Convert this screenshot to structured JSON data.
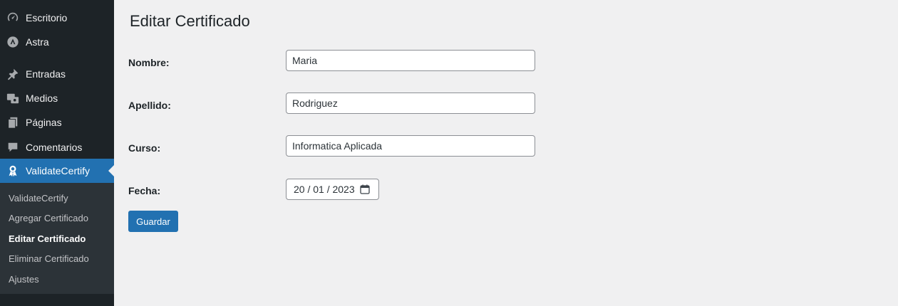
{
  "sidebar": {
    "items": [
      {
        "label": "Escritorio",
        "icon": "dashboard-icon"
      },
      {
        "label": "Astra",
        "icon": "astra-logo-icon"
      },
      {
        "label": "Entradas",
        "icon": "pushpin-icon"
      },
      {
        "label": "Medios",
        "icon": "media-icon"
      },
      {
        "label": "Páginas",
        "icon": "pages-icon"
      },
      {
        "label": "Comentarios",
        "icon": "comment-icon"
      },
      {
        "label": "ValidateCertify",
        "icon": "award-icon"
      }
    ],
    "submenu": [
      {
        "label": "ValidateCertify"
      },
      {
        "label": "Agregar Certificado"
      },
      {
        "label": "Editar Certificado"
      },
      {
        "label": "Eliminar Certificado"
      },
      {
        "label": "Ajustes"
      }
    ]
  },
  "main": {
    "title": "Editar Certificado",
    "form": {
      "nombre_label": "Nombre:",
      "nombre_value": "Maria",
      "apellido_label": "Apellido:",
      "apellido_value": "Rodriguez",
      "curso_label": "Curso:",
      "curso_value": "Informatica Aplicada",
      "fecha_label": "Fecha:",
      "fecha_value": "20 / 01 / 2023",
      "save_label": "Guardar"
    }
  },
  "colors": {
    "sidebar_bg": "#1d2327",
    "submenu_bg": "#2c3338",
    "accent": "#2271b1",
    "page_bg": "#f0f0f1"
  }
}
